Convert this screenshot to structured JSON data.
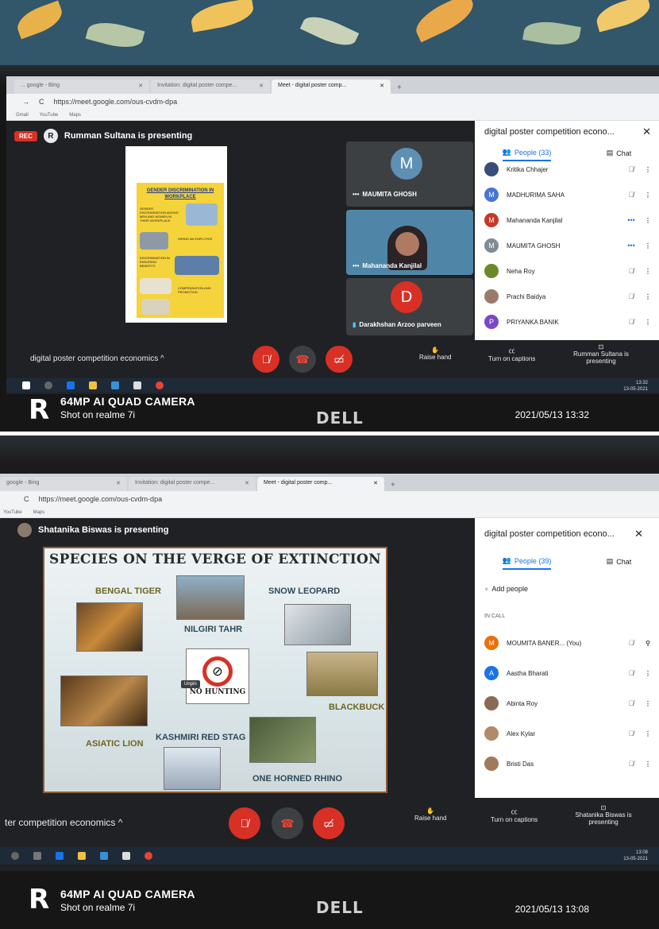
{
  "photo1": {
    "browser": {
      "tabs": [
        "... google - Bing",
        "Invitation: digital poster compe...",
        "Meet - digital poster comp..."
      ],
      "url": "https://meet.google.com/ous-cvdm-dpa",
      "bookmarks": [
        "Gmail",
        "YouTube",
        "Maps"
      ]
    },
    "meet": {
      "rec_label": "REC",
      "presenter_initial": "R",
      "presenting_text": "Rumman Sultana is presenting",
      "poster": {
        "title": "GENDER DISCRIMINATION IN WORKPLACE",
        "bullets": [
          "GENDER DISCRIMINATION AMONG MEN AND WOMEN IN THEIR WORKPLACE",
          "HIRING AN EMPLOYEE",
          "DISCRIMINATION IN ENSURING BENEFITS",
          "COMPENSATION AND PROMOTION"
        ]
      },
      "tiles": [
        {
          "initial": "M",
          "name": "MAUMITA GHOSH",
          "color": "#5f8fb4"
        },
        {
          "name": "Mahananda Kanjilal"
        },
        {
          "initial": "D",
          "name": "Darakhshan Arzoo parveen",
          "color": "#d93025"
        }
      ],
      "panel": {
        "title": "digital poster competition econo...",
        "people_tab": "People (33)",
        "chat_tab": "Chat",
        "people": [
          {
            "name": "Kritika Chhajer",
            "initial": "",
            "color": "#3a4d7a",
            "status": "muted"
          },
          {
            "name": "MADHURIMA SAHA",
            "initial": "M",
            "color": "#4a74d6",
            "status": "muted"
          },
          {
            "name": "Mahananda Kanjilal",
            "initial": "M",
            "color": "#c5392b",
            "status": "speaking"
          },
          {
            "name": "MAUMITA GHOSH",
            "initial": "M",
            "color": "#7f8c95",
            "status": "speaking"
          },
          {
            "name": "Neha Roy",
            "initial": "",
            "color": "#6a8a2a",
            "status": "muted"
          },
          {
            "name": "Prachi Baidya",
            "initial": "",
            "color": "#9a7b6a",
            "status": "muted"
          },
          {
            "name": "PRIYANKA BANIK",
            "initial": "P",
            "color": "#7b48c8",
            "status": "muted"
          }
        ]
      },
      "controls": {
        "meeting_name": "digital poster competition economics",
        "raise_hand": "Raise hand",
        "captions": "Turn on captions",
        "presenting": "Rumman Sultana is presenting"
      },
      "clock": {
        "time": "13:32",
        "date": "13-05-2021"
      }
    },
    "watermark": {
      "camera": "64MP AI QUAD CAMERA",
      "shot": "Shot on realme 7i",
      "datetime": "2021/05/13 13:32"
    },
    "brand": "DELL"
  },
  "photo2": {
    "browser": {
      "tabs": [
        "google - Bing",
        "Invitation: digital poster compe...",
        "Meet - digital poster comp..."
      ],
      "url": "https://meet.google.com/ous-cvdm-dpa",
      "bookmarks": [
        "YouTube",
        "Maps"
      ]
    },
    "meet": {
      "presenting_text": "Shatanika Biswas is presenting",
      "poster": {
        "title": "SPECIES ON THE VERGE OF EXTINCTION",
        "labels": {
          "bengal_tiger": "BENGAL TIGER",
          "nilgiri_tahr": "NILGIRI TAHR",
          "snow_leopard": "SNOW LEOPARD",
          "no_hunting": "NO HUNTING",
          "blackbuck": "BLACKBUCK",
          "asiatic_lion": "ASIATIC LION",
          "kashmiri_red_stag": "KASHMIRI RED STAG",
          "one_horned_rhino": "ONE HORNED RHINO"
        },
        "unpin": "Unpin"
      },
      "panel": {
        "title": "digital poster competition econo...",
        "people_tab": "People (39)",
        "chat_tab": "Chat",
        "add_people": "Add people",
        "in_call": "IN CALL",
        "people": [
          {
            "name": "MOUMITA BANER... (You)",
            "initial": "M",
            "color": "#e8710a",
            "status": "muted-pin"
          },
          {
            "name": "Aastha Bharati",
            "initial": "A",
            "color": "#1a73e8",
            "status": "muted"
          },
          {
            "name": "Abinta Roy",
            "initial": "",
            "color": "#8a6a55",
            "status": "muted"
          },
          {
            "name": "Alex Kylar",
            "initial": "",
            "color": "#b08a6a",
            "status": "muted"
          },
          {
            "name": "Bristi Das",
            "initial": "",
            "color": "#a07a5a",
            "status": "muted"
          }
        ]
      },
      "controls": {
        "meeting_name": "ter competition economics",
        "raise_hand": "Raise hand",
        "captions": "Turn on captions",
        "presenting": "Shatanika Biswas is presenting"
      },
      "clock": {
        "time": "13:08",
        "date": "13-05-2021"
      }
    },
    "watermark": {
      "camera": "64MP AI QUAD CAMERA",
      "shot": "Shot on realme 7i",
      "datetime": "2021/05/13 13:08"
    },
    "brand": "DELL"
  }
}
